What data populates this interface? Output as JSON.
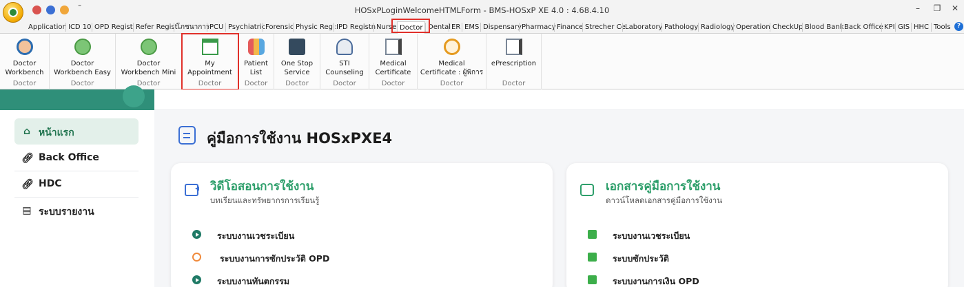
{
  "window": {
    "title": "HOSxPLoginWelcomeHTMLForm - BMS-HOSxP XE 4.0 : 4.68.4.10",
    "qa_dropdown": "⁼",
    "controls": {
      "minimize": "–",
      "restore": "❐",
      "close": "✕"
    }
  },
  "ribbon_tabs": [
    {
      "label": "Application"
    },
    {
      "label": "ICD 10"
    },
    {
      "label": "OPD Regist"
    },
    {
      "label": "Refer Regist"
    },
    {
      "label": "โภชนาการ"
    },
    {
      "label": "PCU"
    },
    {
      "label": "Psychiatric"
    },
    {
      "label": "Forensic"
    },
    {
      "label": "Physic Regi:"
    },
    {
      "label": "IPD Registn"
    },
    {
      "label": "Nurse"
    },
    {
      "label": "Doctor"
    },
    {
      "label": "Dental"
    },
    {
      "label": "ER"
    },
    {
      "label": "EMS"
    },
    {
      "label": "Dispensary"
    },
    {
      "label": "Pharmacy"
    },
    {
      "label": "Finance"
    },
    {
      "label": "Strecher Ce"
    },
    {
      "label": "Laboratory"
    },
    {
      "label": "Pathology"
    },
    {
      "label": "Radiology"
    },
    {
      "label": "Operation"
    },
    {
      "label": "CheckUp"
    },
    {
      "label": "Blood Bank"
    },
    {
      "label": "Back Office"
    },
    {
      "label": "KPI"
    },
    {
      "label": "GIS"
    },
    {
      "label": "HHC"
    },
    {
      "label": "Tools"
    }
  ],
  "active_tab": "Doctor",
  "help_label": "?",
  "ribbon_buttons": [
    {
      "line1": "Doctor",
      "line2": "Workbench",
      "group": "Doctor",
      "icon": "doctor-icon"
    },
    {
      "line1": "Doctor",
      "line2": "Workbench Easy",
      "group": "Doctor",
      "icon": "doctor-easy-icon"
    },
    {
      "line1": "Doctor",
      "line2": "Workbench Mini",
      "group": "Doctor",
      "icon": "doctor-mini-icon"
    },
    {
      "line1": "My",
      "line2": "Appointment",
      "group": "Doctor",
      "icon": "calendar-icon"
    },
    {
      "line1": "Patient",
      "line2": "List",
      "group": "Doctor",
      "icon": "patient-group-icon"
    },
    {
      "line1": "One Stop",
      "line2": "Service",
      "group": "Doctor",
      "icon": "service-desk-icon"
    },
    {
      "line1": "STI",
      "line2": "Counseling",
      "group": "Doctor",
      "icon": "counseling-icon"
    },
    {
      "line1": "Medical",
      "line2": "Certificate",
      "group": "Doctor",
      "icon": "certificate-icon"
    },
    {
      "line1": "Medical",
      "line2": "Certificate : ผู้พิการ",
      "group": "Doctor",
      "icon": "wheelchair-icon"
    },
    {
      "line1": "ePrescription",
      "line2": "",
      "group": "Doctor",
      "icon": "prescription-icon"
    }
  ],
  "sidebar": {
    "items": [
      {
        "label": "หน้าแรก",
        "icon": "home-icon",
        "active": true
      },
      {
        "label": "Back Office",
        "icon": "link-icon"
      },
      {
        "label": "HDC",
        "icon": "link-icon"
      },
      {
        "label": "ระบบรายงาน",
        "icon": "report-icon"
      }
    ]
  },
  "main": {
    "title": "คู่มือการใช้งาน HOSxPXE4",
    "video_card": {
      "title": "วิดีโอสอนการใช้งาน",
      "subtitle": "บทเรียนและทรัพยากรการเรียนรู้",
      "items": [
        {
          "label": "ระบบงานเวชระเบียน",
          "icon": "play-icon"
        },
        {
          "label": "ระบบงานการซักประวัติ OPD",
          "icon": "link-icon"
        },
        {
          "label": "ระบบงานทันตกรรม",
          "icon": "play-icon"
        }
      ]
    },
    "doc_card": {
      "title": "เอกสารคู่มือการใช้งาน",
      "subtitle": "ดาวน์โหลดเอกสารคู่มือการใช้งาน",
      "items": [
        {
          "label": "ระบบงานเวชระเบียน",
          "icon": "pdf-icon"
        },
        {
          "label": "ระบบซักประวัติ",
          "icon": "pdf-icon"
        },
        {
          "label": "ระบบงานการเงิน OPD",
          "icon": "pdf-icon"
        }
      ]
    }
  },
  "colors": {
    "accent_green": "#2e9f6b",
    "highlight_red": "#e0302a",
    "sidebar_active_bg": "#e3f0ea"
  }
}
